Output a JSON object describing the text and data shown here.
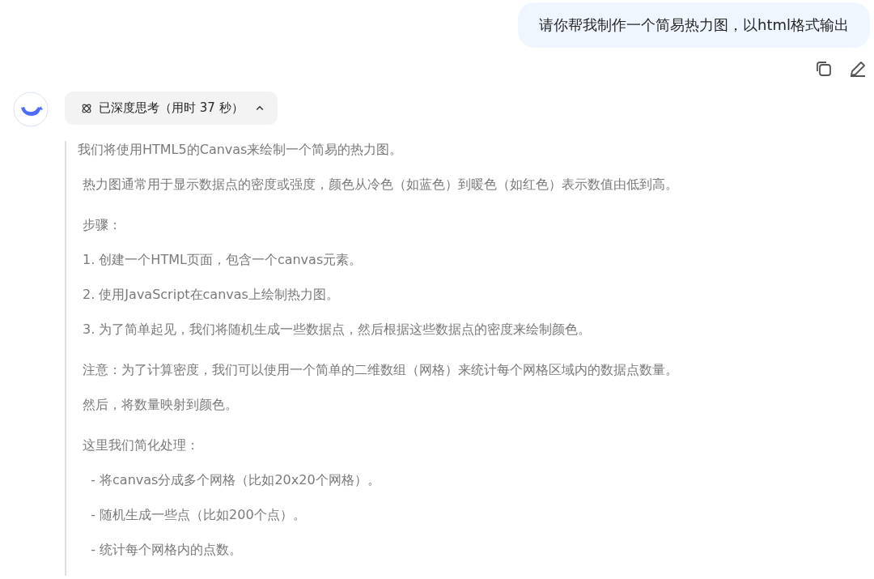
{
  "user_message": {
    "text": "请你帮我制作一个简易热力图，以html格式输出"
  },
  "thinking_toggle": {
    "label": "已深度思考（用时 37 秒）",
    "expanded": true
  },
  "thinking_paragraphs": [
    {
      "lines": [
        "我们将使用HTML5的Canvas来绘制一个简易的热力图。"
      ]
    },
    {
      "lines": [
        "热力图通常用于显示数据点的密度或强度，颜色从冷色（如蓝色）到暖色（如红色）表示数值由低到高。"
      ]
    },
    {
      "lines": [
        "步骤：",
        "1. 创建一个HTML页面，包含一个canvas元素。",
        "2. 使用JavaScript在canvas上绘制热力图。",
        "3. 为了简单起见，我们将随机生成一些数据点，然后根据这些数据点的密度来绘制颜色。"
      ]
    },
    {
      "lines": [
        "注意：为了计算密度，我们可以使用一个简单的二维数组（网格）来统计每个网格区域内的数据点数量。",
        "然后，将数量映射到颜色。"
      ]
    },
    {
      "lines": [
        "这里我们简化处理：",
        "  - 将canvas分成多个网格（比如20x20个网格）。",
        "  - 随机生成一些点（比如200个点）。",
        "  - 统计每个网格内的点数。"
      ]
    }
  ]
}
